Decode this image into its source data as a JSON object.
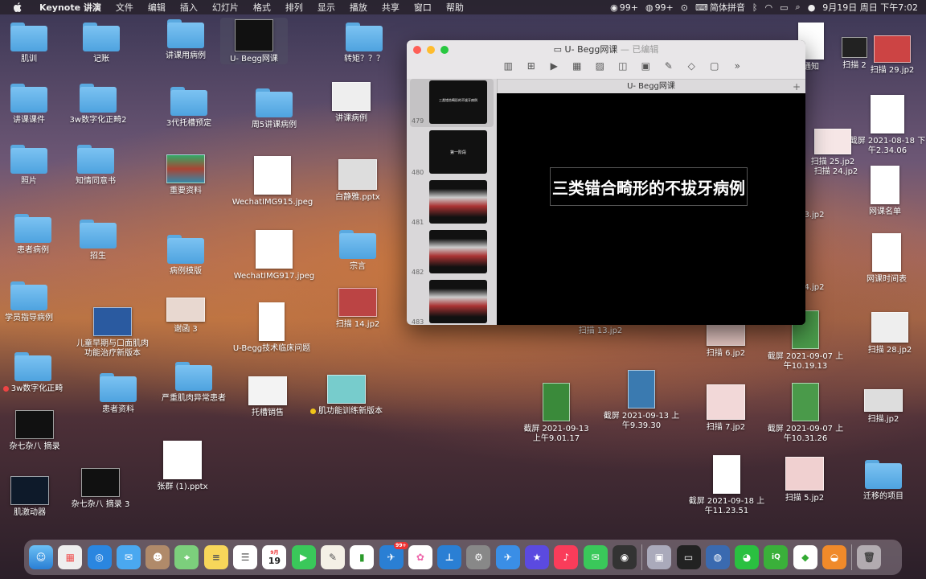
{
  "menubar": {
    "app_name": "Keynote 讲演",
    "items": [
      "文件",
      "编辑",
      "插入",
      "幻灯片",
      "格式",
      "排列",
      "显示",
      "播放",
      "共享",
      "窗口",
      "帮助"
    ],
    "status_wechat": "99+",
    "status_qq": "99+",
    "input_method": "简体拼音",
    "datetime": "9月19日 周日 下午7:02"
  },
  "desktop": {
    "icons": [
      {
        "label": "肌训"
      },
      {
        "label": "记账"
      },
      {
        "label": "讲课用病例"
      },
      {
        "label": "U- Begg网课"
      },
      {
        "label": "转矩？？？"
      },
      {
        "label": "讲课课件"
      },
      {
        "label": "3w数字化正畸2"
      },
      {
        "label": "3代托槽预定"
      },
      {
        "label": "周5讲课病例"
      },
      {
        "label": "讲课病例"
      },
      {
        "label": "照片"
      },
      {
        "label": "知情同意书"
      },
      {
        "label": "重要资料"
      },
      {
        "label": "WechatIMG915.jpeg"
      },
      {
        "label": "白静雅.pptx"
      },
      {
        "label": "患者病例"
      },
      {
        "label": "招生"
      },
      {
        "label": "病例模版"
      },
      {
        "label": "WechatIMG917.jpeg"
      },
      {
        "label": "宗言"
      },
      {
        "label": "学员指导病例"
      },
      {
        "label": "儿童早期与口面肌肉功能治疗新版本"
      },
      {
        "label": "谢函 3"
      },
      {
        "label": "U-Begg技术临床问题"
      },
      {
        "label": "扫描 14.jp2"
      },
      {
        "label": "3w数字化正畸"
      },
      {
        "label": "患者资料"
      },
      {
        "label": "严重肌肉异常患者"
      },
      {
        "label": "托槽销售"
      },
      {
        "label": "肌功能训练新版本"
      },
      {
        "label": "杂七杂八 摘录"
      },
      {
        "label": "杂七杂八 摘录 3"
      },
      {
        "label": "张群 (1).pptx"
      },
      {
        "label": "肌激动器"
      },
      {
        "label": "扫描 13.jp2"
      },
      {
        "label": "截屏 2021-09-13 上午9.01.17"
      },
      {
        "label": "截屏 2021-09-13 上午9.39.30"
      },
      {
        "label": "扫描 6.jp2"
      },
      {
        "label": "截屏 2021-09-07 上午10.19.13"
      },
      {
        "label": "扫描 7.jp2"
      },
      {
        "label": "截屏 2021-09-07 上午10.31.26"
      },
      {
        "label": "截屏 2021-09-18 上午11.23.51"
      },
      {
        "label": "扫描 5.jp2"
      },
      {
        "label": "迁移的项目"
      },
      {
        "label": "扫描 2"
      },
      {
        "label": "扫描 29.jp2"
      },
      {
        "label": "截屏 2021-08-18 下午2.34.06"
      },
      {
        "label": "扫描 25.jp2"
      },
      {
        "label": "扫描 24.jp2"
      },
      {
        "label": "网课名单"
      },
      {
        "label": "网课时间表"
      },
      {
        "label": "3.jp2"
      },
      {
        "label": "4.jp2"
      },
      {
        "label": "扫描 28.jp2"
      },
      {
        "label": "扫描.jp2"
      },
      {
        "label": "通知"
      }
    ]
  },
  "keynote": {
    "title": "U- Begg网课",
    "edited": "— 已编辑",
    "tab": "U- Begg网课",
    "slides": [
      {
        "number": "479",
        "caption": "三类错合畸形的不拔牙病例"
      },
      {
        "number": "480",
        "caption": "第一阶段"
      },
      {
        "number": "481",
        "caption": ""
      },
      {
        "number": "482",
        "caption": ""
      },
      {
        "number": "483",
        "caption": ""
      }
    ],
    "current_slide_title": "三类错合畸形的不拔牙病例"
  },
  "dock": {
    "calendar_month": "9月",
    "calendar_day": "19",
    "wechat_badge": "99+"
  },
  "colors": {
    "folder": "#5aa9e0",
    "keynote_canvas": "#000000"
  }
}
